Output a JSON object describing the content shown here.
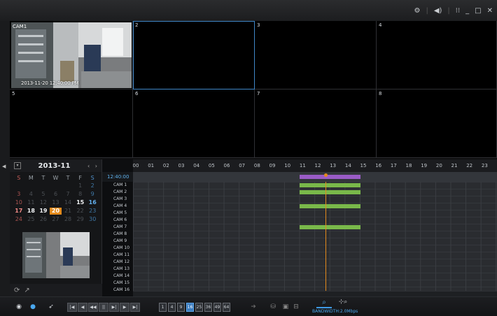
{
  "window": {
    "controls": [
      "⚙",
      "|",
      "◀)",
      "|",
      "⁝⁝",
      "_",
      "□",
      "✕"
    ]
  },
  "grid": {
    "cells": [
      {
        "num": "",
        "cam_name": "CAM1",
        "timestamp": "2013-11-20 12:40:00 PM",
        "has_video": true,
        "selected": false
      },
      {
        "num": "2",
        "has_video": false,
        "selected": true
      },
      {
        "num": "3",
        "has_video": false,
        "selected": false
      },
      {
        "num": "4",
        "has_video": false,
        "selected": false
      },
      {
        "num": "5",
        "has_video": false,
        "selected": false
      },
      {
        "num": "6",
        "has_video": false,
        "selected": false
      },
      {
        "num": "7",
        "has_video": false,
        "selected": false
      },
      {
        "num": "8",
        "has_video": false,
        "selected": false
      }
    ]
  },
  "calendar": {
    "month": "2013-11",
    "prev": "‹",
    "next": "›",
    "dow": [
      "S",
      "M",
      "T",
      "W",
      "T",
      "F",
      "S"
    ],
    "days": [
      {
        "t": "",
        "c": ""
      },
      {
        "t": "",
        "c": ""
      },
      {
        "t": "",
        "c": ""
      },
      {
        "t": "",
        "c": ""
      },
      {
        "t": "",
        "c": ""
      },
      {
        "t": "1",
        "c": "d-muted"
      },
      {
        "t": "2",
        "c": "d-sat"
      },
      {
        "t": "3",
        "c": "d-sun"
      },
      {
        "t": "4",
        "c": "d-muted"
      },
      {
        "t": "5",
        "c": "d-muted"
      },
      {
        "t": "6",
        "c": "d-muted"
      },
      {
        "t": "7",
        "c": "d-muted"
      },
      {
        "t": "8",
        "c": "d-muted"
      },
      {
        "t": "9",
        "c": "d-sat"
      },
      {
        "t": "10",
        "c": "d-sun"
      },
      {
        "t": "11",
        "c": "d-muted"
      },
      {
        "t": "12",
        "c": "d-muted"
      },
      {
        "t": "13",
        "c": "d-muted"
      },
      {
        "t": "14",
        "c": "d-muted"
      },
      {
        "t": "15",
        "c": "d-rec"
      },
      {
        "t": "16",
        "c": "d-rec-sat"
      },
      {
        "t": "17",
        "c": "d-rec-sun"
      },
      {
        "t": "18",
        "c": "d-rec"
      },
      {
        "t": "19",
        "c": "d-rec"
      },
      {
        "t": "20",
        "c": "d-sel"
      },
      {
        "t": "21",
        "c": "d-muted"
      },
      {
        "t": "22",
        "c": "d-muted"
      },
      {
        "t": "23",
        "c": "d-sat"
      },
      {
        "t": "24",
        "c": "d-sun"
      },
      {
        "t": "25",
        "c": "d-muted"
      },
      {
        "t": "26",
        "c": "d-muted"
      },
      {
        "t": "27",
        "c": "d-muted"
      },
      {
        "t": "28",
        "c": "d-muted"
      },
      {
        "t": "29",
        "c": "d-muted"
      },
      {
        "t": "30",
        "c": "d-sat"
      }
    ],
    "selected_day": "20"
  },
  "timeline": {
    "current_time": "12:40:00",
    "hours": [
      "00",
      "01",
      "02",
      "03",
      "04",
      "05",
      "06",
      "07",
      "08",
      "09",
      "10",
      "11",
      "12",
      "13",
      "14",
      "15",
      "16",
      "17",
      "18",
      "19",
      "20",
      "21",
      "22",
      "23"
    ],
    "cameras": [
      "CAM 1",
      "CAM 2",
      "CAM 3",
      "CAM 4",
      "CAM 5",
      "CAM 6",
      "CAM 7",
      "CAM 8",
      "CAM 9",
      "CAM 10",
      "CAM 11",
      "CAM 12",
      "CAM 13",
      "CAM 14",
      "CAM 15",
      "CAM 16"
    ],
    "colors": {
      "all": "#9a5cc6",
      "record": "#79b84a",
      "cursor": "#e38a1c"
    },
    "recordings": [
      {
        "cam": "ALL",
        "start": 11.0,
        "end": 15.0
      },
      {
        "cam": "CAM 1",
        "start": 11.0,
        "end": 15.0
      },
      {
        "cam": "CAM 2",
        "start": 11.0,
        "end": 15.0
      },
      {
        "cam": "CAM 4",
        "start": 11.0,
        "end": 15.0
      },
      {
        "cam": "CAM 7",
        "start": 11.0,
        "end": 15.0
      }
    ],
    "cursor_hour": 12.67
  },
  "toolbar": {
    "playback": [
      "|◀",
      "◀",
      "◀◀",
      "||",
      "▶|",
      "▶",
      "▶|"
    ],
    "splits": [
      {
        "label": "1",
        "on": false
      },
      {
        "label": "4",
        "on": false
      },
      {
        "label": "9",
        "on": false
      },
      {
        "label": "16",
        "on": true
      },
      {
        "label": "25",
        "on": false
      },
      {
        "label": "36",
        "on": false
      },
      {
        "label": "49",
        "on": false
      },
      {
        "label": "64",
        "on": false
      }
    ],
    "bandwidth": "BANDWIDTH:2.0Mbps"
  }
}
